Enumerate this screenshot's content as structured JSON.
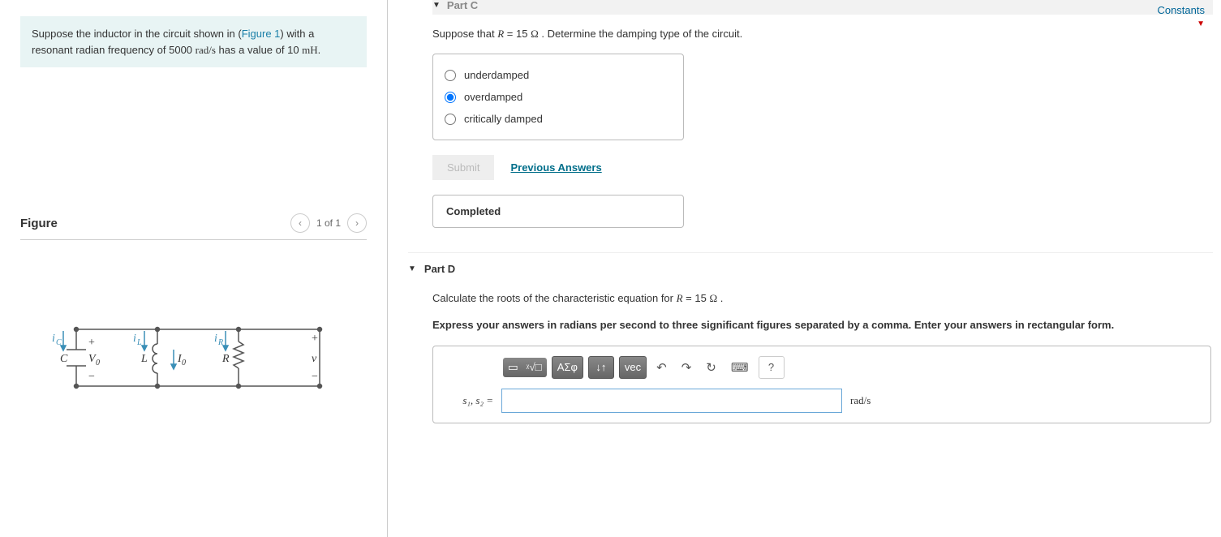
{
  "problem": {
    "prefix": "Suppose the inductor in the circuit shown in (",
    "figure_link": "Figure 1",
    "suffix1": ") with a resonant radian frequency of 5000 ",
    "units1": "rad/s",
    "suffix2": " has a value of 10 ",
    "units2": "mH",
    "suffix3": "."
  },
  "figure": {
    "title": "Figure",
    "counter": "1 of 1"
  },
  "constants_label": "Constants",
  "partC": {
    "title": "Part C",
    "question_prefix": "Suppose that ",
    "question_var": "R",
    "question_eq": " = 15  ",
    "question_unit": "Ω",
    "question_suffix": " . Determine the damping type of the circuit.",
    "options": [
      {
        "label": "underdamped",
        "selected": false
      },
      {
        "label": "overdamped",
        "selected": true
      },
      {
        "label": "critically damped",
        "selected": false
      }
    ],
    "submit": "Submit",
    "prev": "Previous Answers",
    "completed": "Completed"
  },
  "partD": {
    "title": "Part D",
    "question_prefix": "Calculate the roots of the characteristic equation for ",
    "question_var": "R",
    "question_eq": " = 15  ",
    "question_unit": "Ω",
    "question_suffix": " .",
    "instruction": "Express your answers in radians per second to three significant figures separated by a comma. Enter your answers in rectangular form.",
    "answer_label": "s₁, s₂ =",
    "answer_value": "",
    "unit": "rad/s",
    "toolbar": {
      "templates": "x√□",
      "greek": "ΑΣφ",
      "updown": "↓↑",
      "vec": "vec",
      "undo": "↶",
      "redo": "↷",
      "reset": "↻",
      "keyboard": "⌨",
      "help": "?"
    }
  },
  "circuit_labels": {
    "ic": "iC",
    "il": "iL",
    "ir": "iR",
    "C": "C",
    "V0": "V₀",
    "L": "L",
    "I0": "I₀",
    "R": "R",
    "v": "v",
    "plus": "+",
    "minus": "−"
  }
}
